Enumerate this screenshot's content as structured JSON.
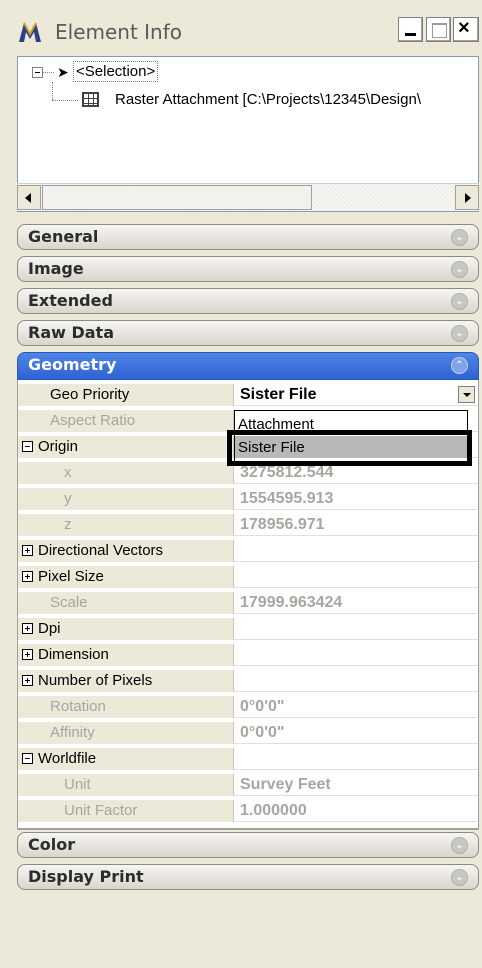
{
  "window": {
    "title": "Element Info",
    "app_icon": "microstation-icon"
  },
  "tree": {
    "root_label": "<Selection>",
    "child_label": "Raster Attachment [C:\\Projects\\12345\\Design\\"
  },
  "sections": {
    "general": "General",
    "image": "Image",
    "extended": "Extended",
    "raw_data": "Raw Data",
    "geometry": "Geometry",
    "color": "Color",
    "display_print": "Display Print"
  },
  "properties": [
    {
      "name": "Geo Priority",
      "value": "Sister File"
    },
    {
      "name": "Aspect Ratio",
      "value": ""
    },
    {
      "name": "Origin",
      "value": ""
    },
    {
      "name": "x",
      "value": "3275812.544"
    },
    {
      "name": "y",
      "value": "1554595.913"
    },
    {
      "name": "z",
      "value": "178956.971"
    },
    {
      "name": "Directional Vectors",
      "value": ""
    },
    {
      "name": "Pixel Size",
      "value": ""
    },
    {
      "name": "Scale",
      "value": "17999.963424"
    },
    {
      "name": "Dpi",
      "value": ""
    },
    {
      "name": "Dimension",
      "value": ""
    },
    {
      "name": "Number of Pixels",
      "value": ""
    },
    {
      "name": "Rotation",
      "value": "0°0'0\""
    },
    {
      "name": "Affinity",
      "value": "0°0'0\""
    },
    {
      "name": "Worldfile",
      "value": ""
    },
    {
      "name": "Unit",
      "value": "Survey Feet"
    },
    {
      "name": "Unit Factor",
      "value": "1.000000"
    }
  ],
  "dropdown": {
    "options": [
      "Attachment",
      "Sister File"
    ],
    "selected": "Sister File"
  },
  "colors": {
    "active_header": "#2f62d3",
    "panel_bg": "#ece9d8",
    "highlight_box": "#000000"
  }
}
